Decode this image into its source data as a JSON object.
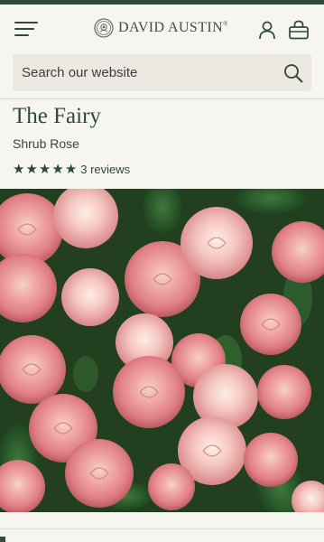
{
  "header": {
    "brand": "DAVID AUSTIN",
    "brand_mark": "®",
    "menu_icon": "hamburger-menu-icon",
    "account_icon": "user-account-icon",
    "bag_icon": "shopping-bag-icon",
    "accent_color": "#2f4a3a"
  },
  "search": {
    "placeholder": "Search our website",
    "value": "",
    "icon": "search-icon"
  },
  "product": {
    "name": "The Fairy",
    "type": "Shrub Rose",
    "rating": 5,
    "rating_max": 5,
    "reviews_label": "3 reviews",
    "image_subject": "pink-rose-cluster-photo"
  }
}
